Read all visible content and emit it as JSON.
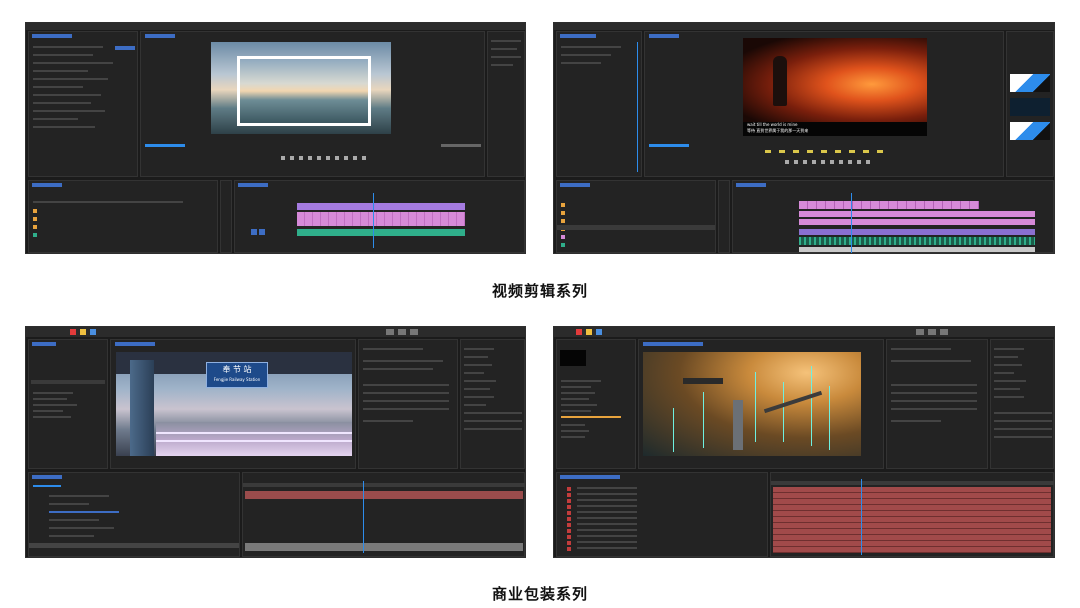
{
  "captions": {
    "video_editing": "视频剪辑系列",
    "commercial_packaging": "商业包装系列"
  },
  "screenshots": {
    "premiere_1": {
      "app": "Adobe Premiere Pro",
      "viewer_content": "lake-landscape-frame"
    },
    "premiere_2": {
      "app": "Adobe Premiere Pro",
      "subtitle_en": "wait till the world is mine",
      "subtitle_cn": "等待 直到世界属于我的那一天到来"
    },
    "after_effects_1": {
      "app": "Adobe After Effects",
      "sign_cn": "奉 节 站",
      "sign_en": "Fengjie Railway Station"
    },
    "after_effects_2": {
      "app": "Adobe After Effects",
      "viewer_content": "aerial-city-night-light-beams"
    }
  },
  "colors": {
    "app_bg": "#1b1b1b",
    "panel_bg": "#232323",
    "accent_blue": "#2d8ceb",
    "clip_pink": "#d68ad8",
    "clip_purple": "#a57be0",
    "clip_green": "#2fae8a",
    "ae_layer_red": "#a14a4a"
  }
}
